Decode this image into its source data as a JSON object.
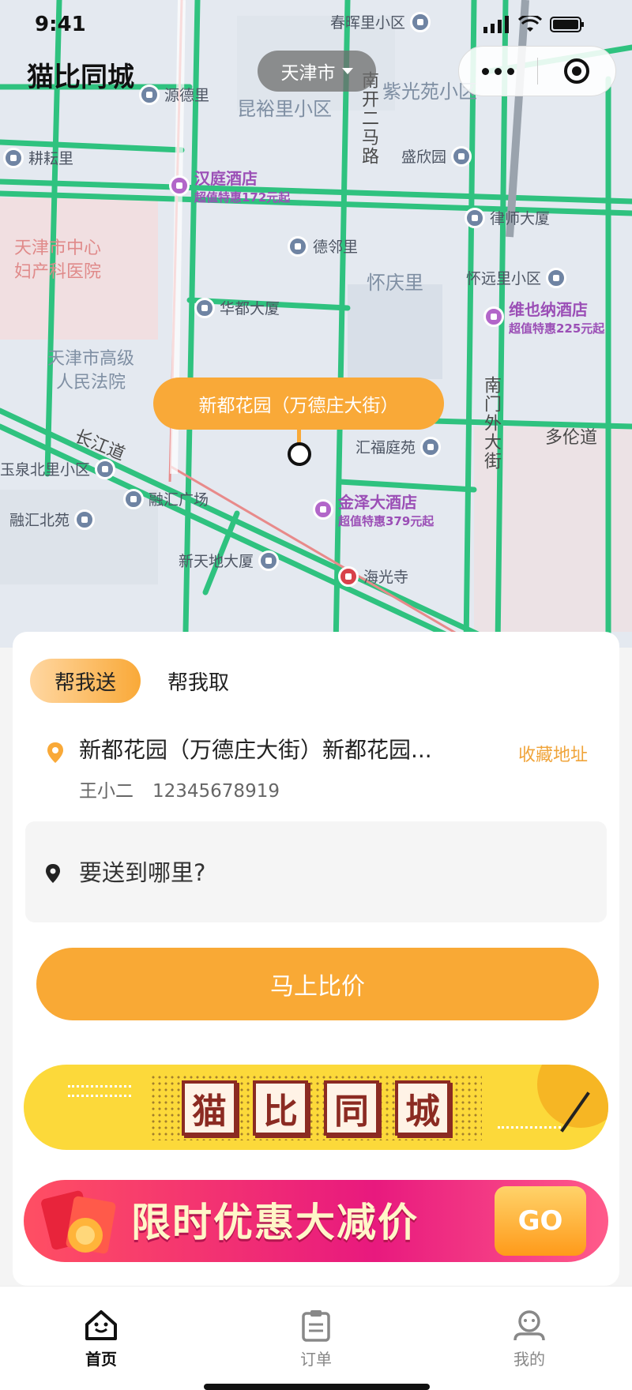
{
  "status": {
    "time": "9:41"
  },
  "header": {
    "app_title": "猫比同城",
    "city": "天津市"
  },
  "map": {
    "current_location": "新都花园（万德庄大街）",
    "pois": [
      {
        "name": "源德里"
      },
      {
        "name": "春晖里小区"
      },
      {
        "name": "耕耘里"
      },
      {
        "name": "汉庭酒店",
        "deal": "超值特惠172元起"
      },
      {
        "name": "德邻里"
      },
      {
        "name": "盛欣园"
      },
      {
        "name": "律师大厦"
      },
      {
        "name": "华都大厦"
      },
      {
        "name": "怀远里小区"
      },
      {
        "name": "维也纳酒店",
        "deal": "超值特惠225元起"
      },
      {
        "name": "汇福庭苑"
      },
      {
        "name": "玉泉北里小区"
      },
      {
        "name": "融汇广场"
      },
      {
        "name": "融汇北苑"
      },
      {
        "name": "金泽大酒店",
        "deal": "超值特惠379元起"
      },
      {
        "name": "新天地大厦"
      },
      {
        "name": "海光寺"
      }
    ],
    "areas": {
      "kunyu": "昆裕里小区",
      "ziguang": "紫光苑小区",
      "huaiqing": "怀庆里",
      "duolun": "多伦道",
      "hospital": [
        "天津市中心",
        "妇产科医院"
      ],
      "court": [
        "天津市高级",
        "人民法院"
      ]
    },
    "roads": {
      "nankai_er_ma": "南开二马路",
      "changjiang": "长江道",
      "nanmenwai": "南门外大街"
    }
  },
  "order": {
    "tabs": [
      "帮我送",
      "帮我取"
    ],
    "from": {
      "address": "新都花园（万德庄大街）新都花园...",
      "name": "王小二",
      "phone": "12345678919"
    },
    "favorite_label": "收藏地址",
    "to_placeholder": "要送到哪里?",
    "compare_button": "马上比价"
  },
  "banners": {
    "brand_chars": [
      "猫",
      "比",
      "同",
      "城"
    ],
    "promo_text": "限时优惠大减价",
    "promo_go": "GO"
  },
  "tabbar": [
    {
      "label": "首页",
      "icon": "home-icon",
      "active": true
    },
    {
      "label": "订单",
      "icon": "clipboard-icon",
      "active": false
    },
    {
      "label": "我的",
      "icon": "profile-icon",
      "active": false
    }
  ],
  "colors": {
    "accent": "#f9a938",
    "road": "#2fc27f",
    "hotel": "#9b4fb6"
  }
}
